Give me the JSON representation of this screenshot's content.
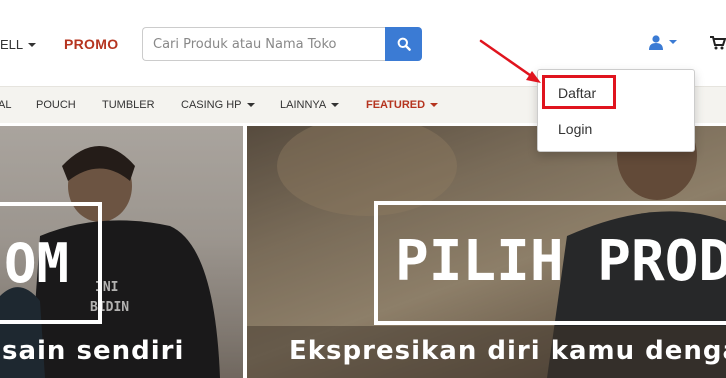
{
  "header": {
    "sell_label": "ELL",
    "promo_label": "PROMO",
    "search_placeholder": "Cari Produk atau Nama Toko"
  },
  "categories": [
    {
      "label": "AL",
      "has_caret": false
    },
    {
      "label": "POUCH",
      "has_caret": false
    },
    {
      "label": "TUMBLER",
      "has_caret": false
    },
    {
      "label": "CASING HP",
      "has_caret": true
    },
    {
      "label": "LAINNYA",
      "has_caret": true
    },
    {
      "label": "FEATURED",
      "has_caret": true
    }
  ],
  "banners": {
    "left_title": "OM",
    "left_sub": "sain sendiri",
    "right_title": "PILIH PRODU",
    "right_sub": "Ekspresikan diri kamu denga"
  },
  "account_menu": {
    "items": [
      "Daftar",
      "Login"
    ]
  },
  "colors": {
    "accent_blue": "#3b7bd4",
    "promo_red": "#b5341f",
    "annotation_red": "#e0141e"
  }
}
